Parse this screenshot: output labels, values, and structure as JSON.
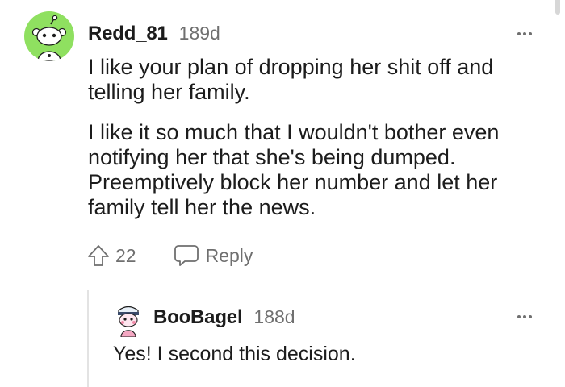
{
  "comments": [
    {
      "username": "Redd_81",
      "age": "189d",
      "paragraphs": [
        "I like your plan of dropping her shit off and telling her family.",
        "I like it so much that I wouldn't bother even notifying her that she's being dumped. Preemptively block her number and let her family tell her the news."
      ],
      "votes": "22",
      "reply_label": "Reply",
      "avatar_color": "#8fe060"
    },
    {
      "username": "BooBagel",
      "age": "188d",
      "text": "Yes! I second this decision."
    }
  ],
  "colors": {
    "text": "#1c1c1c",
    "meta": "#6f6f6f",
    "thread_line": "#e3e3e3"
  },
  "icons": [
    "snoo-avatar",
    "custom-avatar",
    "more-options-icon",
    "upvote-icon",
    "reply-icon"
  ]
}
